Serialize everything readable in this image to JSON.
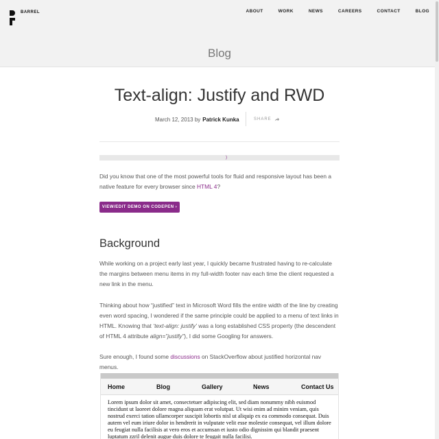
{
  "header": {
    "brand": "BARREL",
    "nav": [
      "ABOUT",
      "WORK",
      "NEWS",
      "CAREERS",
      "CONTACT",
      "BLOG"
    ],
    "section_title": "Blog"
  },
  "post": {
    "title": "Text-align: Justify and RWD",
    "date": "March 12, 2013 by",
    "author": "Patrick Kunka",
    "share_label": "SHARE",
    "intro_before": "Did you know that one of the most powerful tools for fluid and responsive layout has been a native feature for every browser since ",
    "intro_link": "HTML 4",
    "intro_after": "?",
    "demo_button": "VIEW/EDIT DEMO ON CODEPEN  ›",
    "heading": "Background",
    "p2": "While working on a project early last year, I quickly became frustrated having to re-calculate the margins between menu items in my full-width footer nav each time the client requested a new link in the menu.",
    "p3_a": "Thinking about how “justified” text in Microsoft Word fills the entire width of the line by creating even word spacing, I wondered if the same principle could be applied to a menu of text links in HTML. Knowing that ",
    "p3_em1": "‘text-align: justify’",
    "p3_b": " was a long established CSS property (the descendent of HTML 4  attribute ",
    "p3_em2": "align=”justify”",
    "p3_c": "), I did some Googling for answers.",
    "p4_a": "Sure enough, I found some ",
    "p4_link": "discussions",
    "p4_b": " on StackOverflow about justified horizontal nav menus."
  },
  "demo": {
    "nav": [
      "Home",
      "Blog",
      "Gallery",
      "News",
      "Contact Us"
    ],
    "text": "Lorem ipsum dolor sit amet, consectetuer adipiscing elit, sed diam nonummy nibh euismod tincidunt ut laoreet dolore magna aliquam erat volutpat. Ut wisi enim ad minim veniam, quis nostrud exerci tation ullamcorper suscipit lobortis nisl ut aliquip ex ea commodo consequat. Duis autem vel eum iriure dolor in hendrerit in vulputate velit esse molestie consequat, vel illum dolore eu feugiat nulla facilisis at vero eros et accumsan et iusto odio dignissim qui blandit praesent luptatum zzril delenit augue duis dolore te feugait nulla facilisi."
  },
  "colors": {
    "accent": "#8a2b8a",
    "header_bg": "#f2f2f2"
  }
}
